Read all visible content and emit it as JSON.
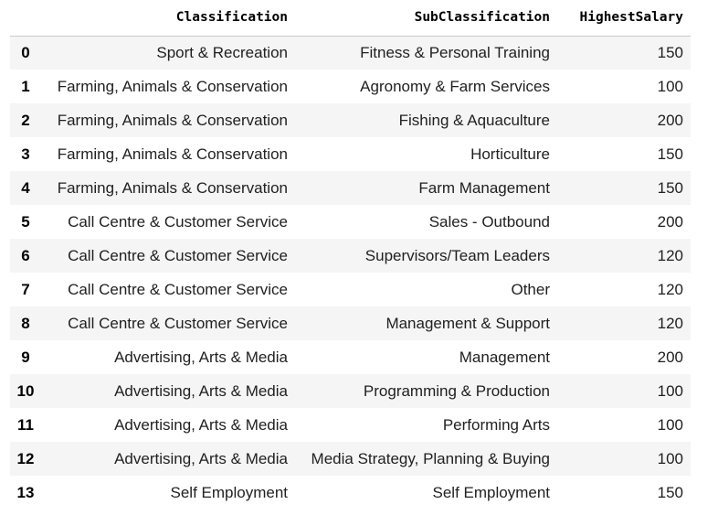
{
  "table": {
    "columns": [
      "Classification",
      "SubClassification",
      "HighestSalary"
    ],
    "rows": [
      {
        "index": "0",
        "classification": "Sport & Recreation",
        "subclassification": "Fitness & Personal Training",
        "highest_salary": "150"
      },
      {
        "index": "1",
        "classification": "Farming, Animals & Conservation",
        "subclassification": "Agronomy & Farm Services",
        "highest_salary": "100"
      },
      {
        "index": "2",
        "classification": "Farming, Animals & Conservation",
        "subclassification": "Fishing & Aquaculture",
        "highest_salary": "200"
      },
      {
        "index": "3",
        "classification": "Farming, Animals & Conservation",
        "subclassification": "Horticulture",
        "highest_salary": "150"
      },
      {
        "index": "4",
        "classification": "Farming, Animals & Conservation",
        "subclassification": "Farm Management",
        "highest_salary": "150"
      },
      {
        "index": "5",
        "classification": "Call Centre & Customer Service",
        "subclassification": "Sales - Outbound",
        "highest_salary": "200"
      },
      {
        "index": "6",
        "classification": "Call Centre & Customer Service",
        "subclassification": "Supervisors/Team Leaders",
        "highest_salary": "120"
      },
      {
        "index": "7",
        "classification": "Call Centre & Customer Service",
        "subclassification": "Other",
        "highest_salary": "120"
      },
      {
        "index": "8",
        "classification": "Call Centre & Customer Service",
        "subclassification": "Management & Support",
        "highest_salary": "120"
      },
      {
        "index": "9",
        "classification": "Advertising, Arts & Media",
        "subclassification": "Management",
        "highest_salary": "200"
      },
      {
        "index": "10",
        "classification": "Advertising, Arts & Media",
        "subclassification": "Programming & Production",
        "highest_salary": "100"
      },
      {
        "index": "11",
        "classification": "Advertising, Arts & Media",
        "subclassification": "Performing Arts",
        "highest_salary": "100"
      },
      {
        "index": "12",
        "classification": "Advertising, Arts & Media",
        "subclassification": "Media Strategy, Planning & Buying",
        "highest_salary": "100"
      },
      {
        "index": "13",
        "classification": "Self Employment",
        "subclassification": "Self Employment",
        "highest_salary": "150"
      }
    ]
  }
}
